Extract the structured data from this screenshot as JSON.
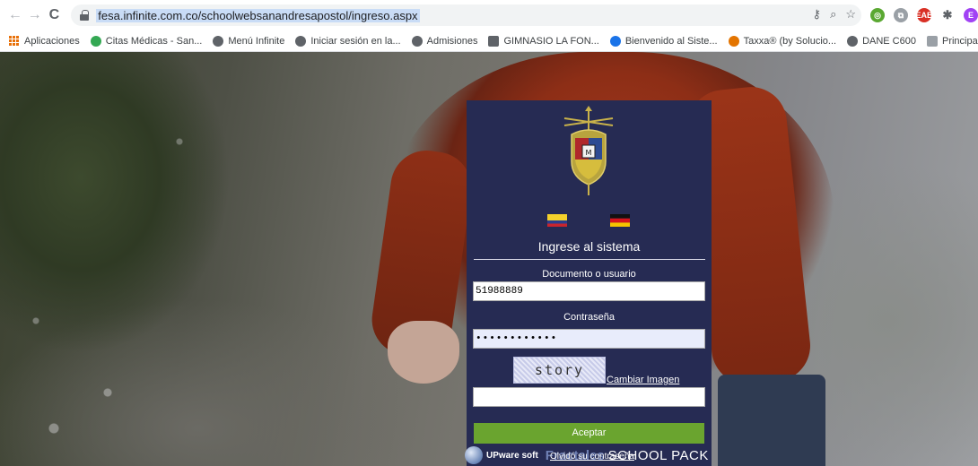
{
  "browser": {
    "url": "fesa.infinite.com.co/schoolwebsanandresapostol/ingreso.aspx",
    "nav": {
      "back": "←",
      "forward": "→",
      "reload": "C"
    },
    "omnibox_icons": {
      "key": "key-icon",
      "zoom": "zoom-icon",
      "star": "star-icon"
    },
    "extensions": [
      {
        "name": "compass-extension-icon",
        "color": "#5aa832",
        "glyph": "◎"
      },
      {
        "name": "screenshot-extension-icon",
        "color": "#9aa0a6",
        "glyph": "⧉"
      },
      {
        "name": "red-extension-icon",
        "color": "#d93025",
        "glyph": "EAB"
      },
      {
        "name": "puzzle-extensions-icon",
        "color": "#5f6368",
        "glyph": "✱"
      },
      {
        "name": "profile-avatar",
        "color": "#a142f4",
        "glyph": "E"
      }
    ]
  },
  "bookmarks": [
    {
      "label": "Aplicaciones",
      "icon": "apps-icon",
      "color": "#e8710a"
    },
    {
      "label": "Citas Médicas - San...",
      "icon": "medical-icon",
      "color": "#34a853"
    },
    {
      "label": "Menú Infinite",
      "icon": "globe-icon",
      "color": "#5f6368"
    },
    {
      "label": "Iniciar sesión en la...",
      "icon": "globe-icon",
      "color": "#5f6368"
    },
    {
      "label": "Admisiones",
      "icon": "globe-icon",
      "color": "#5f6368"
    },
    {
      "label": "GIMNASIO LA FON...",
      "icon": "monitor-icon",
      "color": "#5f6368"
    },
    {
      "label": "Bienvenido al Siste...",
      "icon": "check-icon",
      "color": "#1a73e8"
    },
    {
      "label": "Taxxa® (by Solucio...",
      "icon": "taxxa-icon",
      "color": "#e37400"
    },
    {
      "label": "DANE C600",
      "icon": "globe-icon",
      "color": "#5f6368"
    },
    {
      "label": "Principal",
      "icon": "page-icon",
      "color": "#9aa0a6"
    }
  ],
  "login": {
    "title": "Ingrese al sistema",
    "user_label": "Documento o usuario",
    "user_value": "51988889",
    "password_label": "Contraseña",
    "password_value": "••••••••••••",
    "captcha_text": "story",
    "captcha_link": "Cambiar Imagen",
    "captcha_value": "",
    "submit_label": "Aceptar",
    "forgot_link": "Olvidó su contraseña"
  },
  "footer_logos": {
    "upware": "UPware soft",
    "fractales": "Fractales",
    "schoolpack": "SCHOOL PACK"
  },
  "colors": {
    "panel_bg": "#262b53",
    "button": "#6aa42f",
    "url_highlight": "#c9dcf6"
  }
}
